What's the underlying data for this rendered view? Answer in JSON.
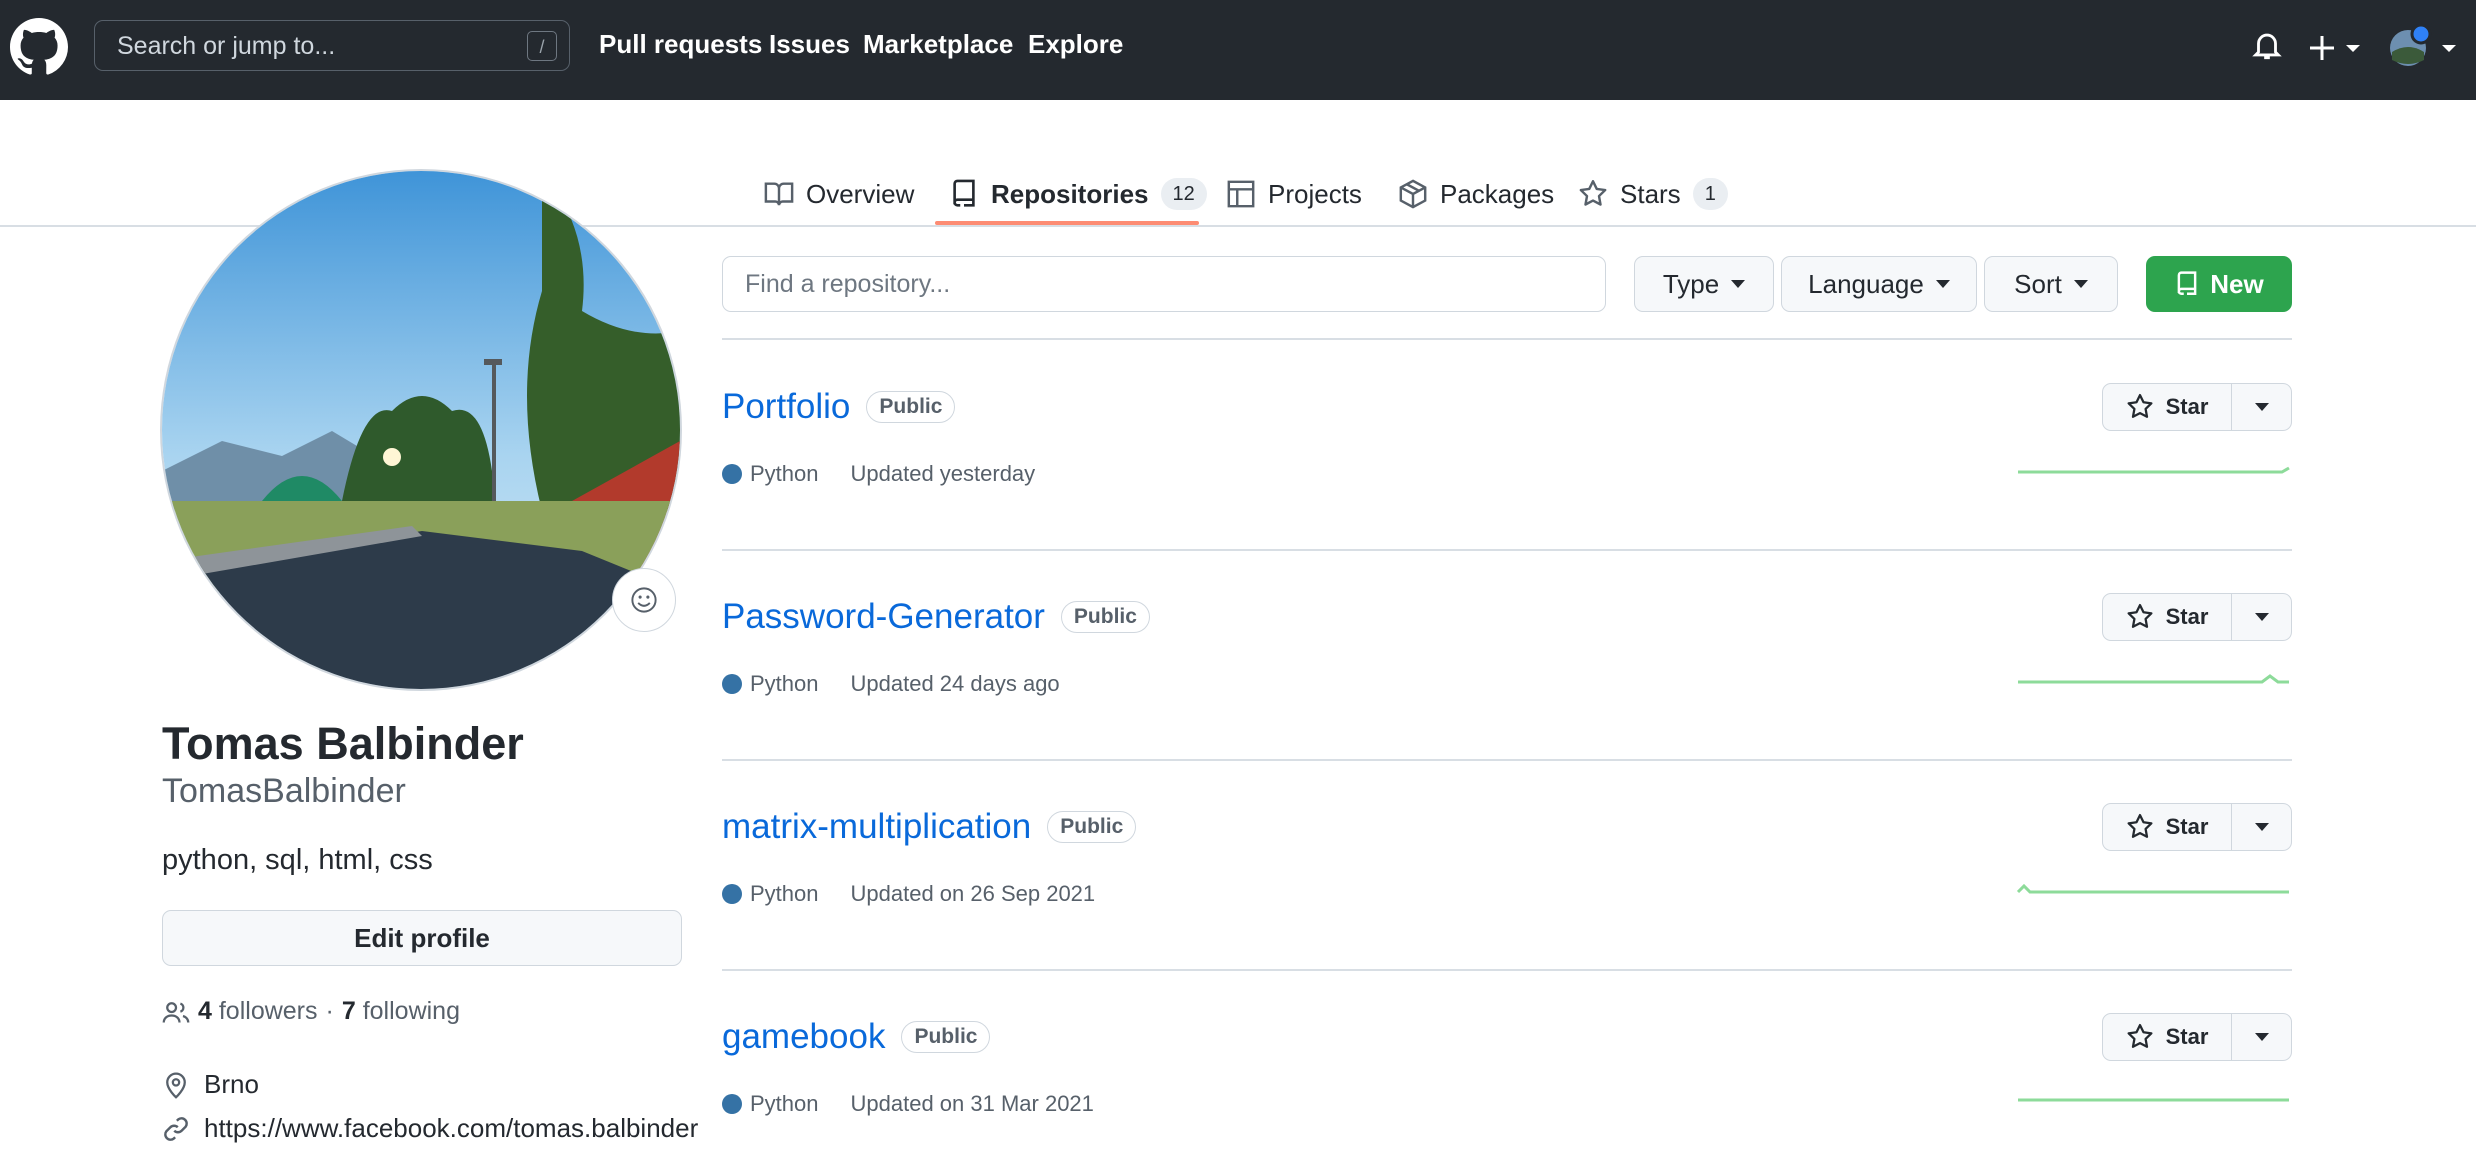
{
  "header": {
    "search_placeholder": "Search or jump to...",
    "search_shortcut": "/",
    "nav": [
      "Pull requests",
      "Issues",
      "Marketplace",
      "Explore"
    ],
    "plus_label": "+"
  },
  "tabs": [
    {
      "label": "Overview",
      "icon": "book-icon"
    },
    {
      "label": "Repositories",
      "count": "12",
      "icon": "repo-icon",
      "selected": true
    },
    {
      "label": "Projects",
      "icon": "table-icon"
    },
    {
      "label": "Packages",
      "icon": "package-icon"
    },
    {
      "label": "Stars",
      "count": "1",
      "icon": "star-icon"
    }
  ],
  "profile": {
    "full_name": "Tomas Balbinder",
    "username": "TomasBalbinder",
    "bio": "python, sql, html, css",
    "edit_label": "Edit profile",
    "followers_count": "4",
    "followers_label": "followers",
    "separator": "·",
    "following_count": "7",
    "following_label": "following",
    "location": "Brno",
    "website": "https://www.facebook.com/tomas.balbinder"
  },
  "filters": {
    "find_placeholder": "Find a repository...",
    "type_label": "Type",
    "language_label": "Language",
    "sort_label": "Sort",
    "new_label": "New"
  },
  "repos": [
    {
      "name": "Portfolio",
      "visibility": "Public",
      "language": "Python",
      "updated": "Updated yesterday",
      "star_label": "Star"
    },
    {
      "name": "Password-Generator",
      "visibility": "Public",
      "language": "Python",
      "updated": "Updated 24 days ago",
      "star_label": "Star"
    },
    {
      "name": "matrix-multiplication",
      "visibility": "Public",
      "language": "Python",
      "updated": "Updated on 26 Sep 2021",
      "star_label": "Star"
    },
    {
      "name": "gamebook",
      "visibility": "Public",
      "language": "Python",
      "updated": "Updated on 31 Mar 2021",
      "star_label": "Star"
    }
  ],
  "colors": {
    "header_bg": "#24292f",
    "link": "#0969da",
    "new_button": "#2da44e",
    "python_dot": "#3572a5",
    "tab_underline": "#fd8c73",
    "sparkline": "#8ddb9a"
  }
}
